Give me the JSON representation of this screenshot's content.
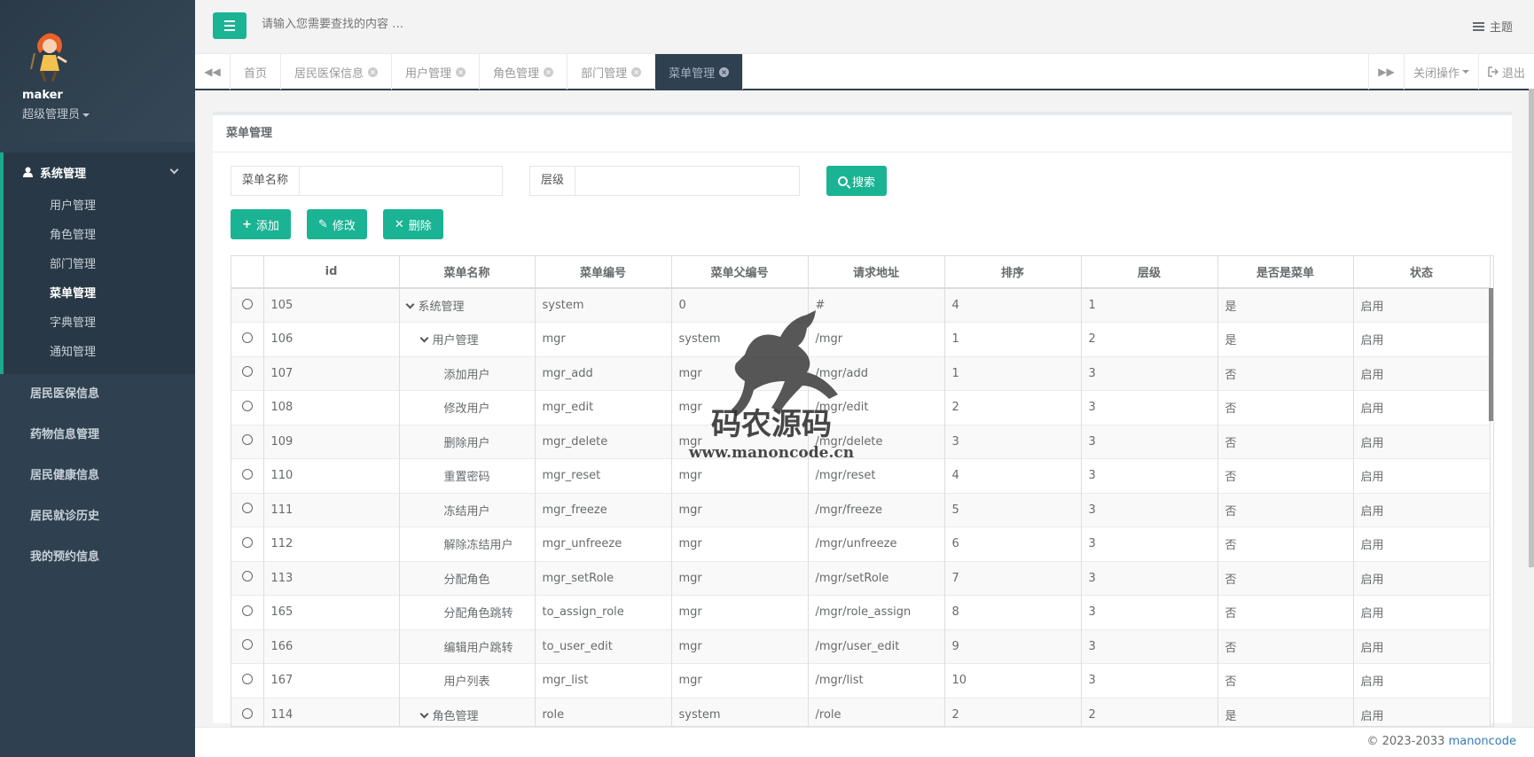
{
  "user": {
    "name": "maker",
    "role": "超级管理员"
  },
  "sidebar": {
    "group": {
      "label": "系统管理",
      "items": [
        {
          "label": "用户管理",
          "active": false
        },
        {
          "label": "角色管理",
          "active": false
        },
        {
          "label": "部门管理",
          "active": false
        },
        {
          "label": "菜单管理",
          "active": true
        },
        {
          "label": "字典管理",
          "active": false
        },
        {
          "label": "通知管理",
          "active": false
        }
      ]
    },
    "items": [
      "居民医保信息",
      "药物信息管理",
      "居民健康信息",
      "居民就诊历史",
      "我的预约信息"
    ]
  },
  "topbar": {
    "search_placeholder": "请输入您需要查找的内容 …",
    "theme_label": "主题"
  },
  "tabs": [
    "首页",
    "居民医保信息",
    "用户管理",
    "角色管理",
    "部门管理",
    "菜单管理"
  ],
  "active_tab": "菜单管理",
  "tab_actions": {
    "close_ops": "关闭操作",
    "logout": "退出"
  },
  "panel": {
    "title": "菜单管理"
  },
  "filters": {
    "menu_name_label": "菜单名称",
    "level_label": "层级",
    "search_button": "搜索"
  },
  "toolbar": {
    "add": "添加",
    "edit": "修改",
    "delete": "删除"
  },
  "table": {
    "columns": [
      "id",
      "菜单名称",
      "菜单编号",
      "菜单父编号",
      "请求地址",
      "排序",
      "层级",
      "是否是菜单",
      "状态"
    ],
    "rows": [
      {
        "id": "105",
        "name": "系统管理",
        "indent": 0,
        "expand": true,
        "code": "system",
        "pcode": "0",
        "url": "#",
        "sort": "4",
        "level": "1",
        "ismenu": "是",
        "status": "启用"
      },
      {
        "id": "106",
        "name": "用户管理",
        "indent": 1,
        "expand": true,
        "code": "mgr",
        "pcode": "system",
        "url": "/mgr",
        "sort": "1",
        "level": "2",
        "ismenu": "是",
        "status": "启用"
      },
      {
        "id": "107",
        "name": "添加用户",
        "indent": 2,
        "expand": false,
        "code": "mgr_add",
        "pcode": "mgr",
        "url": "/mgr/add",
        "sort": "1",
        "level": "3",
        "ismenu": "否",
        "status": "启用"
      },
      {
        "id": "108",
        "name": "修改用户",
        "indent": 2,
        "expand": false,
        "code": "mgr_edit",
        "pcode": "mgr",
        "url": "/mgr/edit",
        "sort": "2",
        "level": "3",
        "ismenu": "否",
        "status": "启用"
      },
      {
        "id": "109",
        "name": "删除用户",
        "indent": 2,
        "expand": false,
        "code": "mgr_delete",
        "pcode": "mgr",
        "url": "/mgr/delete",
        "sort": "3",
        "level": "3",
        "ismenu": "否",
        "status": "启用"
      },
      {
        "id": "110",
        "name": "重置密码",
        "indent": 2,
        "expand": false,
        "code": "mgr_reset",
        "pcode": "mgr",
        "url": "/mgr/reset",
        "sort": "4",
        "level": "3",
        "ismenu": "否",
        "status": "启用"
      },
      {
        "id": "111",
        "name": "冻结用户",
        "indent": 2,
        "expand": false,
        "code": "mgr_freeze",
        "pcode": "mgr",
        "url": "/mgr/freeze",
        "sort": "5",
        "level": "3",
        "ismenu": "否",
        "status": "启用"
      },
      {
        "id": "112",
        "name": "解除冻结用户",
        "indent": 2,
        "expand": false,
        "code": "mgr_unfreeze",
        "pcode": "mgr",
        "url": "/mgr/unfreeze",
        "sort": "6",
        "level": "3",
        "ismenu": "否",
        "status": "启用"
      },
      {
        "id": "113",
        "name": "分配角色",
        "indent": 2,
        "expand": false,
        "code": "mgr_setRole",
        "pcode": "mgr",
        "url": "/mgr/setRole",
        "sort": "7",
        "level": "3",
        "ismenu": "否",
        "status": "启用"
      },
      {
        "id": "165",
        "name": "分配角色跳转",
        "indent": 2,
        "expand": false,
        "code": "to_assign_role",
        "pcode": "mgr",
        "url": "/mgr/role_assign",
        "sort": "8",
        "level": "3",
        "ismenu": "否",
        "status": "启用"
      },
      {
        "id": "166",
        "name": "编辑用户跳转",
        "indent": 2,
        "expand": false,
        "code": "to_user_edit",
        "pcode": "mgr",
        "url": "/mgr/user_edit",
        "sort": "9",
        "level": "3",
        "ismenu": "否",
        "status": "启用"
      },
      {
        "id": "167",
        "name": "用户列表",
        "indent": 2,
        "expand": false,
        "code": "mgr_list",
        "pcode": "mgr",
        "url": "/mgr/list",
        "sort": "10",
        "level": "3",
        "ismenu": "否",
        "status": "启用"
      },
      {
        "id": "114",
        "name": "角色管理",
        "indent": 1,
        "expand": true,
        "code": "role",
        "pcode": "system",
        "url": "/role",
        "sort": "2",
        "level": "2",
        "ismenu": "是",
        "status": "启用"
      }
    ]
  },
  "watermark": {
    "title": "码农源码",
    "url": "www.manoncode.cn"
  },
  "footer": {
    "copyright": "© 2023-2033",
    "link": "manoncode"
  },
  "colors": {
    "accent": "#1ab394",
    "sidebar": "#2f4050",
    "sidebar_active": "#293846"
  }
}
